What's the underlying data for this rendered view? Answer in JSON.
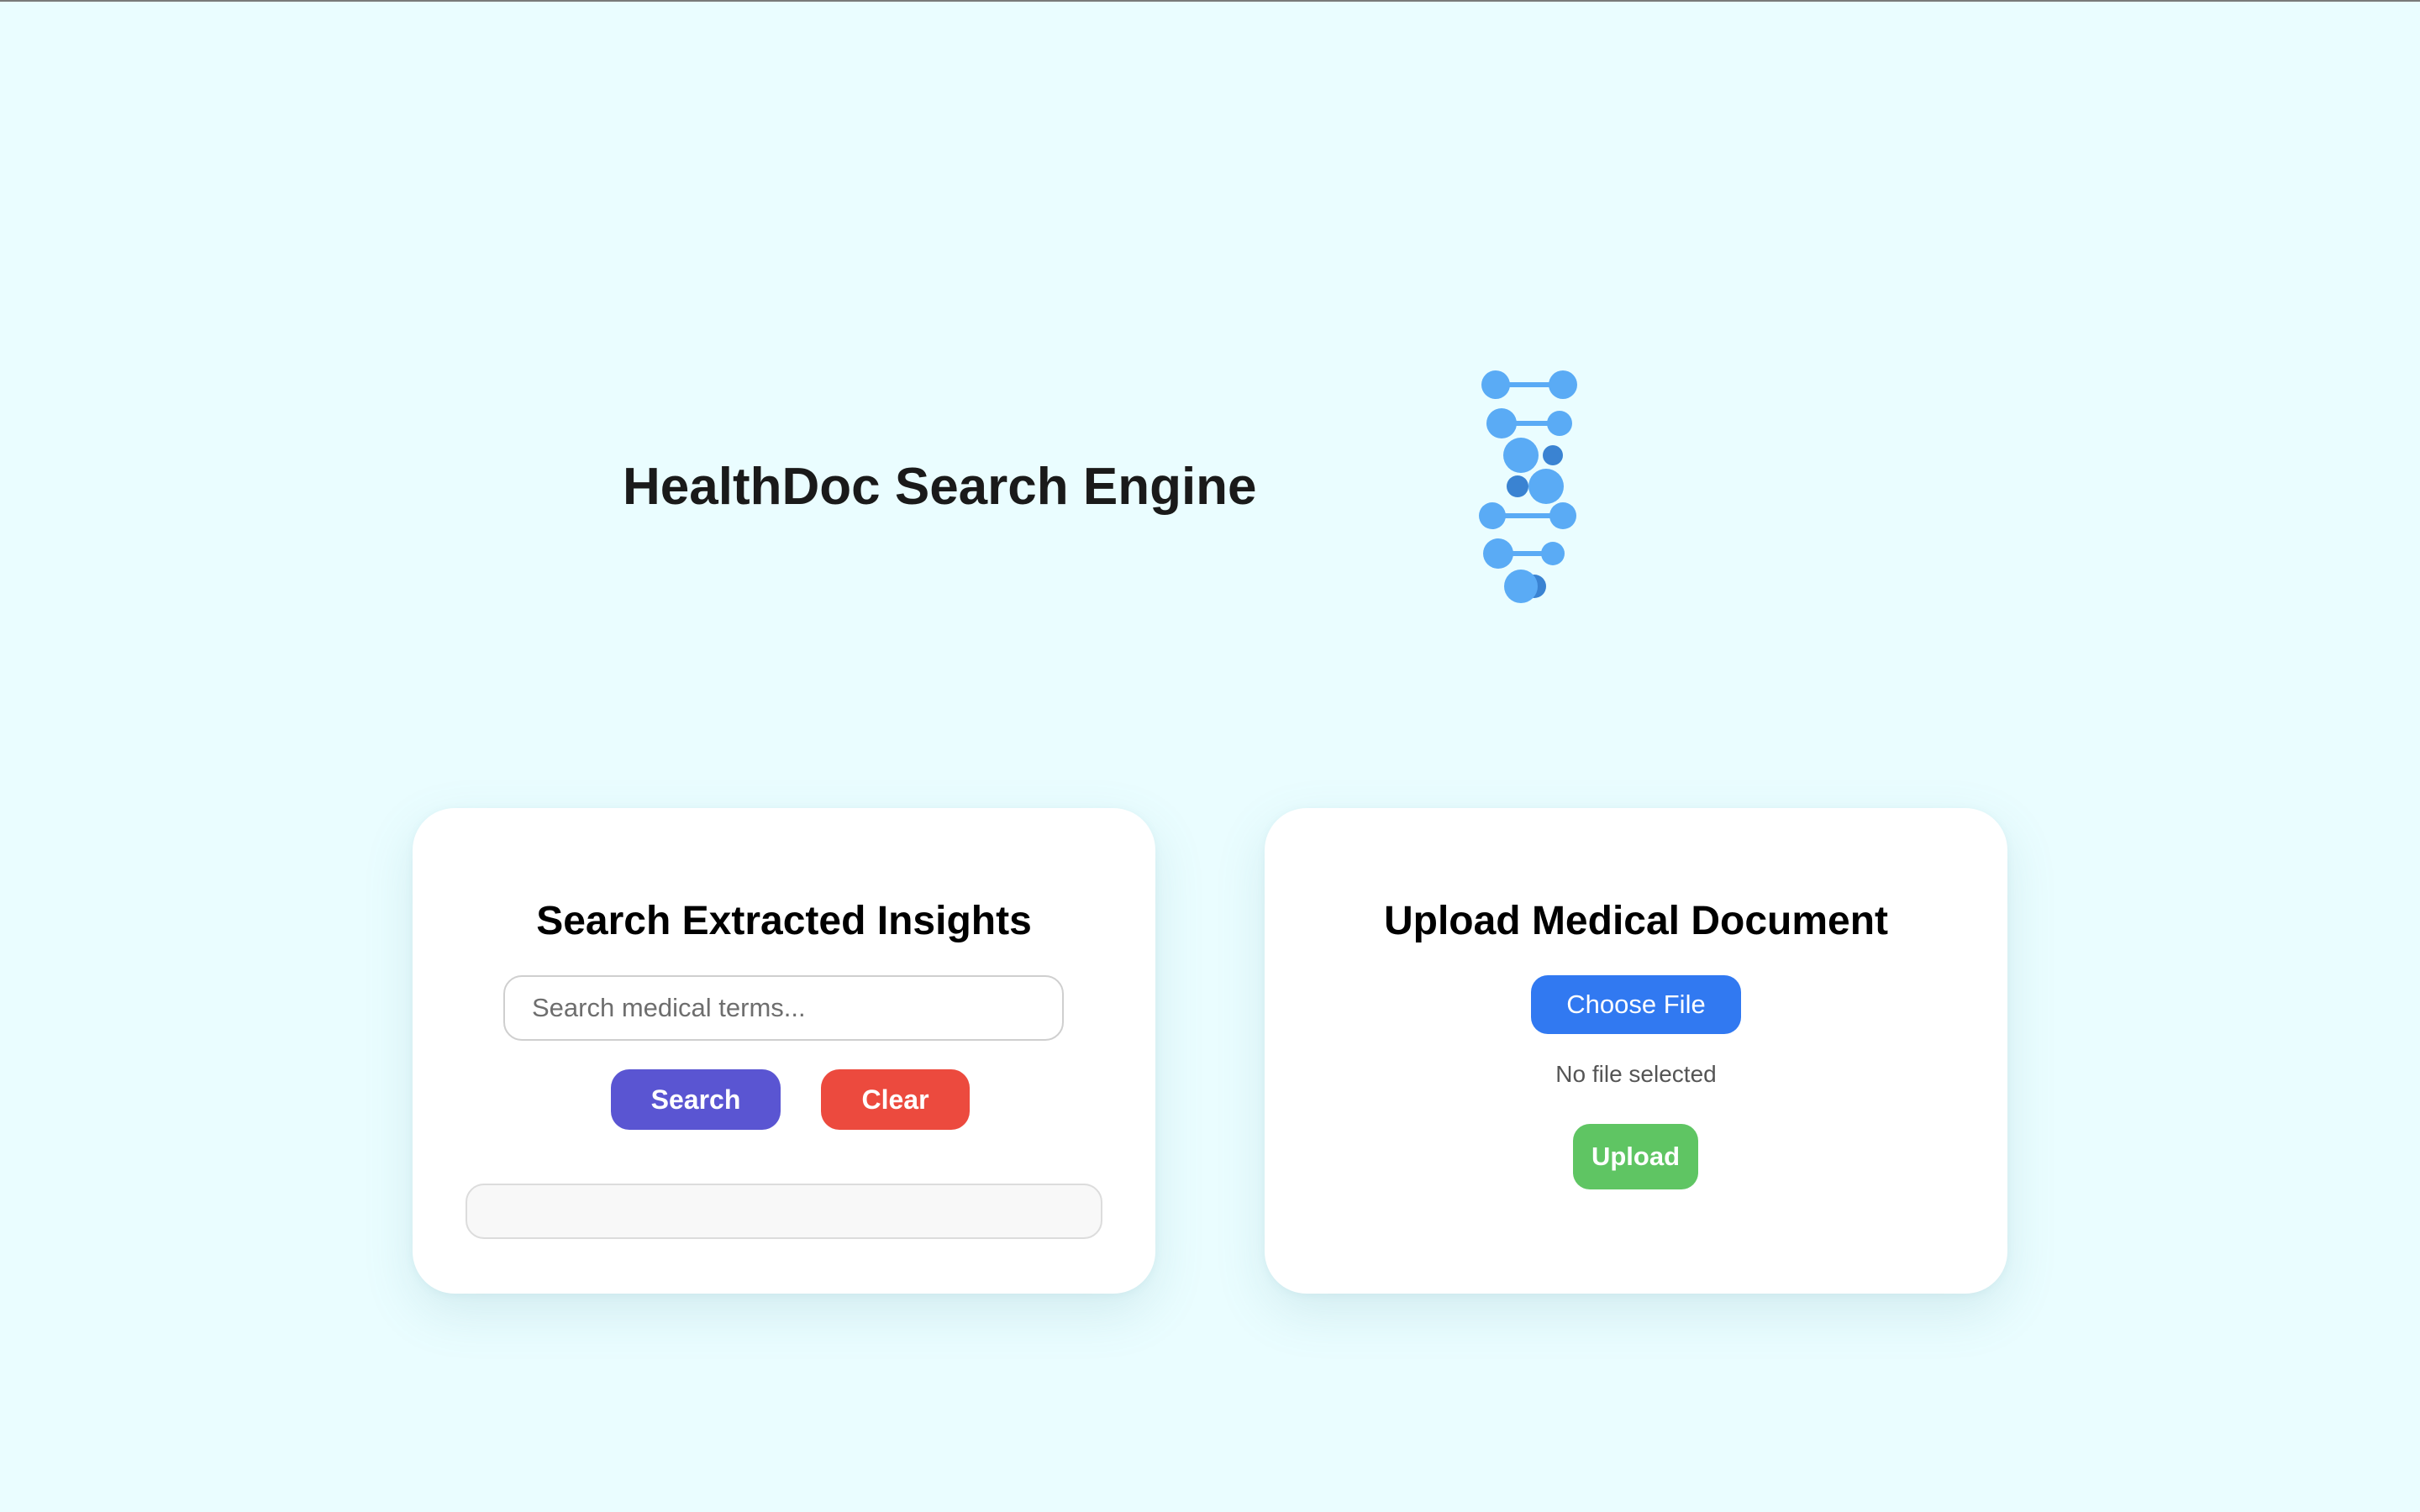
{
  "header": {
    "title": "HealthDoc Search Engine",
    "logo_icon": "dna-icon"
  },
  "search_panel": {
    "title": "Search Extracted Insights",
    "input_value": "",
    "input_placeholder": "Search medical terms...",
    "search_label": "Search",
    "clear_label": "Clear",
    "results_text": ""
  },
  "upload_panel": {
    "title": "Upload Medical Document",
    "choose_label": "Choose File",
    "file_status": "No file selected",
    "upload_label": "Upload"
  },
  "colors": {
    "page_background": "#eafdff",
    "card_background": "#ffffff",
    "search_button": "#5a55d2",
    "clear_button": "#ec4a3e",
    "choose_button": "#3179f1",
    "upload_button": "#5fc563",
    "dna_light": "#5aabf5",
    "dna_dark": "#3a83d2"
  }
}
